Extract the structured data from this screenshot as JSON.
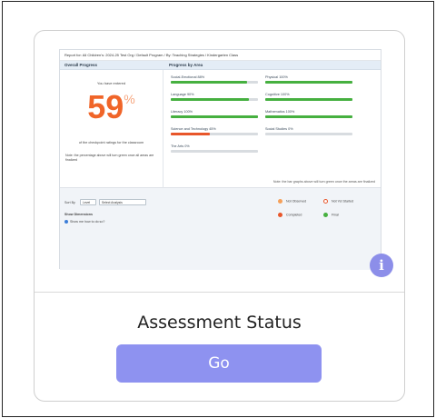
{
  "card": {
    "title": "Assessment Status",
    "go_label": "Go",
    "info_icon": "info-icon",
    "info_glyph": "i",
    "accent": "#8e92f0"
  },
  "preview": {
    "breadcrumb": "Report for: All Children's: 2024-25 Test Org / Default Program / By: Teaching Strategies / Kindergarten Class",
    "overall_header": "Overall Progress",
    "progress_header": "Progress by Area",
    "you_have_entered": "You have entered",
    "percent_value": "59",
    "percent_symbol": "%",
    "of_text": "of the checkpoint ratings for the classroom",
    "note_text": "Note: the percentage above will turn green once all areas are finalized",
    "bottom_note": "Note: the bar graphs above will turn green once the areas are finalized",
    "areas": [
      {
        "label": "Social-Emotional 88%",
        "percent": 88,
        "color": "#46b040"
      },
      {
        "label": "Physical 100%",
        "percent": 100,
        "color": "#46b040"
      },
      {
        "label": "Language 90%",
        "percent": 90,
        "color": "#46b040"
      },
      {
        "label": "Cognitive 100%",
        "percent": 100,
        "color": "#46b040"
      },
      {
        "label": "Literacy 100%",
        "percent": 100,
        "color": "#46b040"
      },
      {
        "label": "Mathematics 100%",
        "percent": 100,
        "color": "#46b040"
      },
      {
        "label": "Science and Technology 45%",
        "percent": 45,
        "color": "#e8562a"
      },
      {
        "label": "Social Studies 0%",
        "percent": 0,
        "color": "#46b040"
      },
      {
        "label": "The Arts 0%",
        "percent": 0,
        "color": "#46b040"
      }
    ],
    "filters": {
      "sort_label": "Sort By",
      "sort_value": "Level",
      "view_value": "Select Analysis",
      "show_dimensions": "Show Dimensions",
      "radio_label": "Show me how to do so?"
    },
    "legend": [
      {
        "label": "Not Observed",
        "color": "#f5a05a",
        "hollow": false
      },
      {
        "label": "Not Yet Started",
        "color": "#e8562a",
        "hollow": true
      },
      {
        "label": "Completed",
        "color": "#e8562a",
        "hollow": false
      },
      {
        "label": "Final",
        "color": "#46b040",
        "hollow": false
      }
    ]
  }
}
